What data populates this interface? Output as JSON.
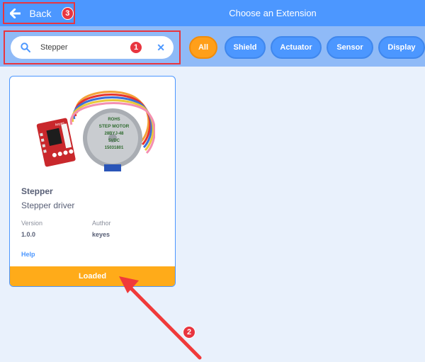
{
  "header": {
    "back_label": "Back",
    "title": "Choose an Extension",
    "back_badge": "3"
  },
  "search": {
    "value": "Stepper",
    "badge": "1",
    "clear_icon": "close-icon"
  },
  "filters": [
    "All",
    "Shield",
    "Actuator",
    "Sensor",
    "Display"
  ],
  "active_filter": "All",
  "extension": {
    "name": "Stepper",
    "description": "Stepper driver",
    "version_label": "Version",
    "version": "1.0.0",
    "author_label": "Author",
    "author": "keyes",
    "help_label": "Help",
    "status": "Loaded",
    "image_labels": {
      "motor_brand": "ROHS",
      "motor_line1": "STEP MOTOR",
      "motor_line2": "28BYJ-48",
      "motor_line3": "5VDC",
      "motor_line4": "15031801",
      "board_label": "keyes"
    }
  },
  "annotation": {
    "badge": "2"
  },
  "colors": {
    "header": "#4c97ff",
    "filter_bar": "#8fbaf7",
    "active_filter": "#ff9f1a",
    "loaded": "#ffab19",
    "highlight": "#e8353f"
  }
}
